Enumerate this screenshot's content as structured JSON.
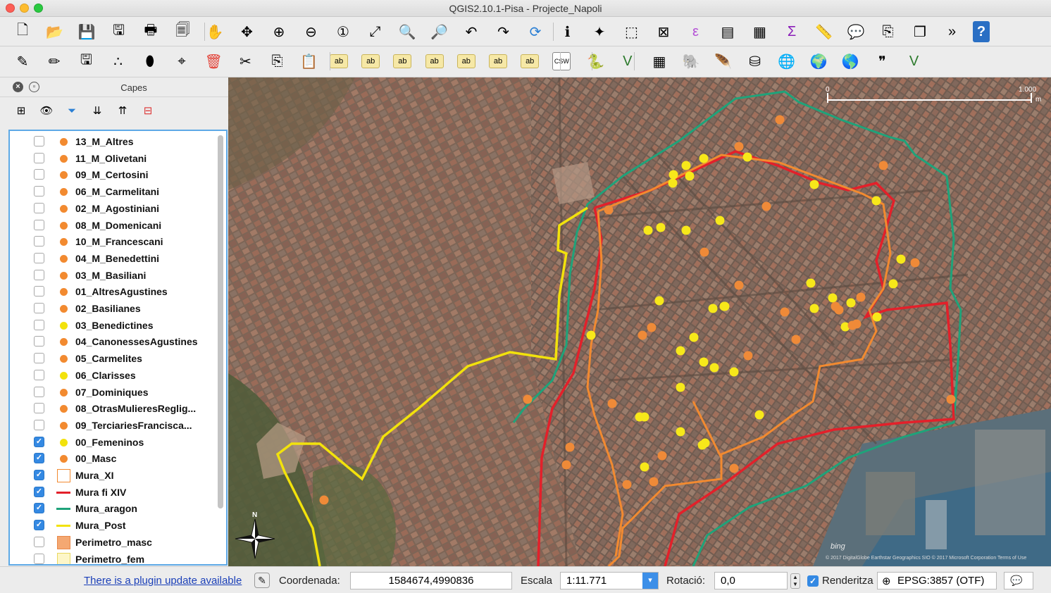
{
  "window": {
    "title": "QGIS2.10.1-Pisa - Projecte_Napoli"
  },
  "toolbar1": {
    "icons": [
      "new-project-icon",
      "open-project-icon",
      "save-project-icon",
      "save-as-icon",
      "new-print-composer-icon",
      "composer-manager-icon",
      "pan-map-icon",
      "pan-to-selection-icon",
      "zoom-in-icon",
      "zoom-out-icon",
      "zoom-native-icon",
      "zoom-full-icon",
      "zoom-to-selection-icon",
      "zoom-to-layer-icon",
      "zoom-last-icon",
      "zoom-next-icon",
      "refresh-icon",
      "identify-icon",
      "touch-zoom-icon",
      "select-features-icon",
      "deselect-icon",
      "field-calculator-icon",
      "attribute-table-icon",
      "statistics-icon",
      "sum-icon",
      "measure-icon",
      "map-tips-icon",
      "new-bookmark-icon",
      "show-bookmarks-icon",
      "more-tools-icon",
      "help-icon"
    ]
  },
  "toolbar2": {
    "icons": [
      "current-edits-icon",
      "toggle-editing-icon",
      "save-edits-icon",
      "add-feature-icon",
      "move-feature-icon",
      "node-tool-icon",
      "delete-selected-icon",
      "cut-features-icon",
      "copy-features-icon",
      "paste-features-icon",
      "label-toolbar-icon",
      "pin-labels-icon",
      "highlight-pinned-icon",
      "show-hide-labels-icon",
      "move-label-icon",
      "rotate-label-icon",
      "change-label-icon",
      "csw-icon",
      "python-console-icon",
      "add-vector-layer-icon",
      "add-raster-layer-icon",
      "add-postgis-icon",
      "add-spatialite-icon",
      "add-mssql-icon",
      "add-wms-icon",
      "add-wcs-icon",
      "add-wfs-icon",
      "add-delimited-text-icon",
      "new-shapefile-icon"
    ],
    "csw_label": "CSW"
  },
  "layers_panel": {
    "title": "Capes",
    "tools": [
      "add-group-icon",
      "manage-visibility-icon",
      "filter-legend-icon",
      "expand-all-icon",
      "collapse-all-icon",
      "remove-layer-icon"
    ],
    "layers": [
      {
        "name": "13_M_Altres",
        "checked": false,
        "symbol": "dot",
        "color": "#f28a30"
      },
      {
        "name": "11_M_Olivetani",
        "checked": false,
        "symbol": "dot",
        "color": "#f28a30"
      },
      {
        "name": "09_M_Certosini",
        "checked": false,
        "symbol": "dot",
        "color": "#f28a30"
      },
      {
        "name": "06_M_Carmelitani",
        "checked": false,
        "symbol": "dot",
        "color": "#f28a30"
      },
      {
        "name": "02_M_Agostiniani",
        "checked": false,
        "symbol": "dot",
        "color": "#f28a30"
      },
      {
        "name": "08_M_Domenicani",
        "checked": false,
        "symbol": "dot",
        "color": "#f28a30"
      },
      {
        "name": "10_M_Francescani",
        "checked": false,
        "symbol": "dot",
        "color": "#f28a30"
      },
      {
        "name": "04_M_Benedettini",
        "checked": false,
        "symbol": "dot",
        "color": "#f28a30"
      },
      {
        "name": "03_M_Basiliani",
        "checked": false,
        "symbol": "dot",
        "color": "#f28a30"
      },
      {
        "name": "01_AltresAgustines",
        "checked": false,
        "symbol": "dot",
        "color": "#f28a30"
      },
      {
        "name": "02_Basilianes",
        "checked": false,
        "symbol": "dot",
        "color": "#f28a30"
      },
      {
        "name": "03_Benedictines",
        "checked": false,
        "symbol": "dot",
        "color": "#f2e20c"
      },
      {
        "name": "04_CanonessesAgustines",
        "checked": false,
        "symbol": "dot",
        "color": "#f28a30"
      },
      {
        "name": "05_Carmelites",
        "checked": false,
        "symbol": "dot",
        "color": "#f28a30"
      },
      {
        "name": "06_Clarisses",
        "checked": false,
        "symbol": "dot",
        "color": "#f2e20c"
      },
      {
        "name": "07_Dominiques",
        "checked": false,
        "symbol": "dot",
        "color": "#f28a30"
      },
      {
        "name": "08_OtrasMulieresReglig...",
        "checked": false,
        "symbol": "dot",
        "color": "#f28a30"
      },
      {
        "name": "09_TerciariesFrancisca...",
        "checked": false,
        "symbol": "dot",
        "color": "#f28a30"
      },
      {
        "name": "00_Femeninos",
        "checked": true,
        "symbol": "dot",
        "color": "#f2e20c"
      },
      {
        "name": "00_Masc",
        "checked": true,
        "symbol": "dot",
        "color": "#f28a30"
      },
      {
        "name": "Mura_XI",
        "checked": true,
        "symbol": "poly",
        "color": "#f28a30",
        "fill": "#ffffff"
      },
      {
        "name": "Mura fi XIV",
        "checked": true,
        "symbol": "line",
        "color": "#e3202a"
      },
      {
        "name": "Mura_aragon",
        "checked": true,
        "symbol": "line",
        "color": "#1fa37a"
      },
      {
        "name": "Mura_Post",
        "checked": true,
        "symbol": "line",
        "color": "#f2e20c"
      },
      {
        "name": "Perimetro_masc",
        "checked": false,
        "symbol": "poly",
        "color": "#e8884a",
        "fill": "#f4a872"
      },
      {
        "name": "Perimetro_fem",
        "checked": false,
        "symbol": "poly",
        "color": "#e8d860",
        "fill": "#fdf6c8"
      }
    ]
  },
  "map": {
    "scale_bar": {
      "start": "0",
      "end": "1.000",
      "unit": "m"
    },
    "north_label": "N",
    "bing_label": "bing",
    "attribution": "© 2017 DigitalGlobe Earthstar Geographics SIO © 2017 Microsoft Corporation Terms of Use",
    "colors": {
      "femeninos": "#f7e81a",
      "masc": "#ef8a38",
      "mura_xi": "#f28a30",
      "mura_xiv": "#e3202a",
      "aragon": "#1fa37a",
      "post": "#f2e20c"
    }
  },
  "status": {
    "plugin_link": "There is a plugin update available",
    "coord_label": "Coordenada:",
    "coord_value": "1584674,4990836",
    "scale_label": "Escala",
    "scale_value": "1:11.771",
    "rotation_label": "Rotació:",
    "rotation_value": "0,0",
    "render_label": "Renderitza",
    "render_checked": true,
    "crs": "EPSG:3857 (OTF)"
  }
}
